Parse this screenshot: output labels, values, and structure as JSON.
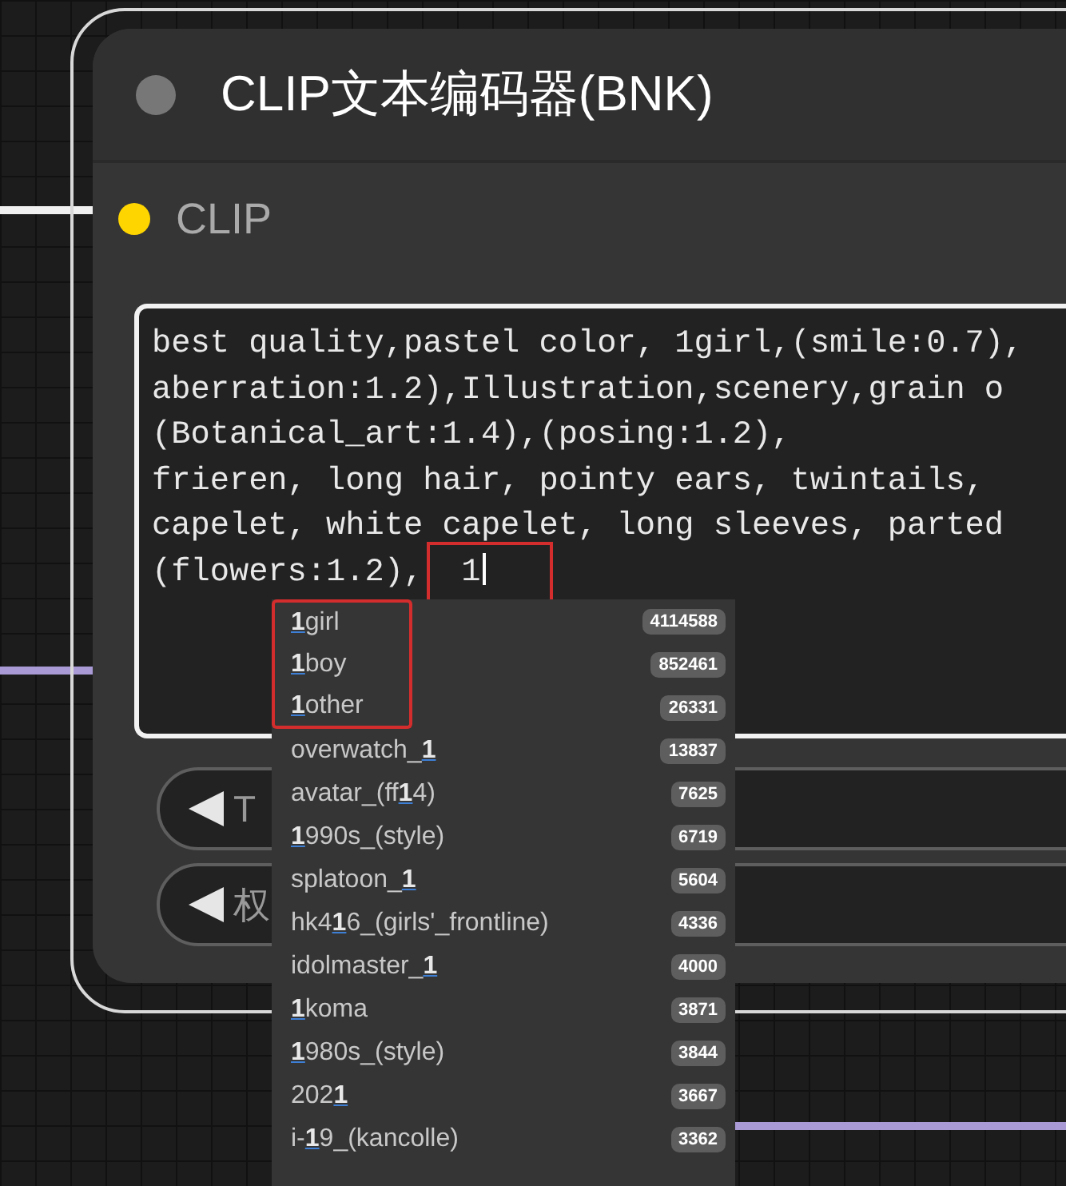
{
  "node": {
    "title": "CLIP文本编码器(BNK)",
    "input": {
      "label": "CLIP"
    },
    "prompt": {
      "lines": [
        "best quality,pastel color, 1girl,(smile:0.7),",
        "aberration:1.2),Illustration,scenery,grain o",
        "(Botanical_art:1.4),(posing:1.2),",
        "frieren, long hair, pointy ears, twintails,",
        "capelet, white capelet, long sleeves, parted",
        "(flowers:1.2),"
      ],
      "typed": "1",
      "typed_highlighted": true
    },
    "widgets": [
      {
        "label": "T"
      },
      {
        "label": "权"
      }
    ]
  },
  "autocomplete": {
    "items": [
      {
        "label": "**1**girl",
        "count": "4114588",
        "highlighted": true
      },
      {
        "label": "**1**boy",
        "count": "852461",
        "highlighted": true
      },
      {
        "label": "**1**other",
        "count": "26331",
        "highlighted": true
      },
      {
        "label": "overwatch_**1**",
        "count": "13837",
        "highlighted": false
      },
      {
        "label": "avatar_(ff**1**4)",
        "count": "7625",
        "highlighted": false
      },
      {
        "label": "**1**990s_(style)",
        "count": "6719",
        "highlighted": false
      },
      {
        "label": "splatoon_**1**",
        "count": "5604",
        "highlighted": false
      },
      {
        "label": "hk4**1**6_(girls'_frontline)",
        "count": "4336",
        "highlighted": false
      },
      {
        "label": "idolmaster_**1**",
        "count": "4000",
        "highlighted": false
      },
      {
        "label": "**1**koma",
        "count": "3871",
        "highlighted": false
      },
      {
        "label": "**1**980s_(style)",
        "count": "3844",
        "highlighted": false
      },
      {
        "label": "202**1**",
        "count": "3667",
        "highlighted": false
      },
      {
        "label": "i-**1**9_(kancolle)",
        "count": "3362",
        "highlighted": false
      }
    ]
  }
}
